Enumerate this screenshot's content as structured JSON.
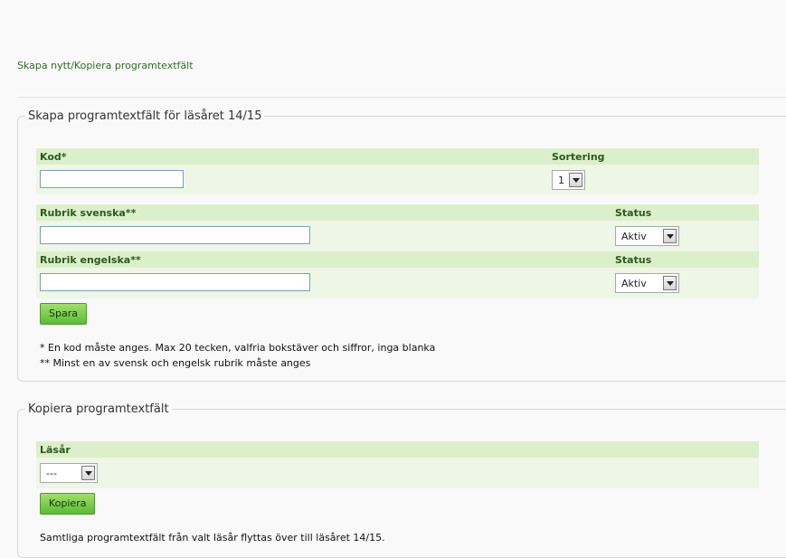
{
  "page": {
    "link": "Skapa nytt/Kopiera programtextfält"
  },
  "create": {
    "legend": "Skapa programtextfält för läsåret 14/15",
    "kod_label": "Kod*",
    "kod_value": "",
    "sortering_label": "Sortering",
    "sortering_value": "1",
    "rubrik_sv_label": "Rubrik svenska**",
    "rubrik_sv_value": "",
    "status_label": "Status",
    "status_sv_value": "Aktiv",
    "rubrik_en_label": "Rubrik engelska**",
    "rubrik_en_value": "",
    "status_en_value": "Aktiv",
    "save_label": "Spara",
    "note1": "* En kod måste anges. Max 20 tecken, valfria bokstäver och siffror, inga blanka",
    "note2": "** Minst en av svensk och engelsk rubrik måste anges"
  },
  "copy": {
    "legend": "Kopiera programtextfält",
    "lasar_label": "Läsår",
    "lasar_value": "---",
    "copy_label": "Kopiera",
    "note": "Samtliga programtextfält från valt läsår flyttas över till läsåret 14/15."
  },
  "colors": {
    "band_head": "#dcefcb",
    "band_body": "#eef6e6",
    "label_green": "#2b5a1d",
    "button_green": "#5dbb35"
  },
  "icons": {
    "select_arrow": "chevron-down-icon"
  }
}
